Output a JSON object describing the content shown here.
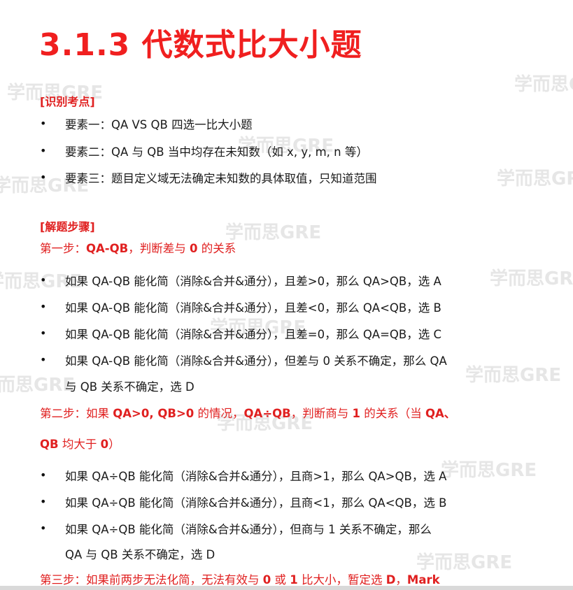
{
  "title": "3.1.3 代数式比大小题",
  "watermark_text": "学而思GRE",
  "section_identify": {
    "tag": "[识别考点]",
    "items": [
      "要素一：QA VS QB 四选一比大小题",
      "要素二：QA 与 QB 当中均存在未知数（如 x, y, m, n 等）",
      "要素三：题目定义域无法确定未知数的具体取值，只知道范围"
    ]
  },
  "section_solve": {
    "tag": "[解题步骤]",
    "step1": {
      "prefix": "第一步：",
      "bold": "QA-QB",
      "middle": "，判断差与 ",
      "bold2": "0",
      "suffix": " 的关系"
    },
    "step1_items": [
      "如果 QA-QB 能化简（消除&合并&通分），且差>0，那么 QA>QB，选 A",
      "如果 QA-QB 能化简（消除&合并&通分），且差<0，那么 QA<QB，选 B",
      "如果 QA-QB 能化简（消除&合并&通分），且差=0，那么 QA=QB，选 C",
      "如果 QA-QB 能化简（消除&合并&通分），但差与 0 关系不确定，那么 QA",
      "与 QB 关系不确定，选 D"
    ],
    "step2_line1": {
      "prefix": "第二步：如果 ",
      "bold": "QA>0, QB>0",
      "middle": " 的情况，",
      "bold2": "QA÷QB",
      "middle2": "，判断商与 ",
      "bold3": "1",
      "suffix": " 的关系（当 ",
      "bold4": "QA、"
    },
    "step2_line2": {
      "bold": "QB",
      "middle": " 均大于 ",
      "bold2": "0",
      "suffix": "）"
    },
    "step2_items": [
      "如果 QA÷QB 能化简（消除&合并&通分），且商>1，那么 QA>QB，选 A",
      "如果 QA÷QB 能化简（消除&合并&通分），且商<1，那么 QA<QB，选 B",
      "如果 QA÷QB 能化简（消除&合并&通分），但商与 1 关系不确定，那么",
      "QA 与 QB 关系不确定，选 D"
    ],
    "step3": {
      "prefix": "第三步：如果前两步无法化简，无法有效与 ",
      "bold": "0",
      "middle": " 或 ",
      "bold2": "1",
      "middle2": " 比大小，暂定选 ",
      "bold3": "D",
      "middle3": "，",
      "bold4": "Mark"
    }
  }
}
